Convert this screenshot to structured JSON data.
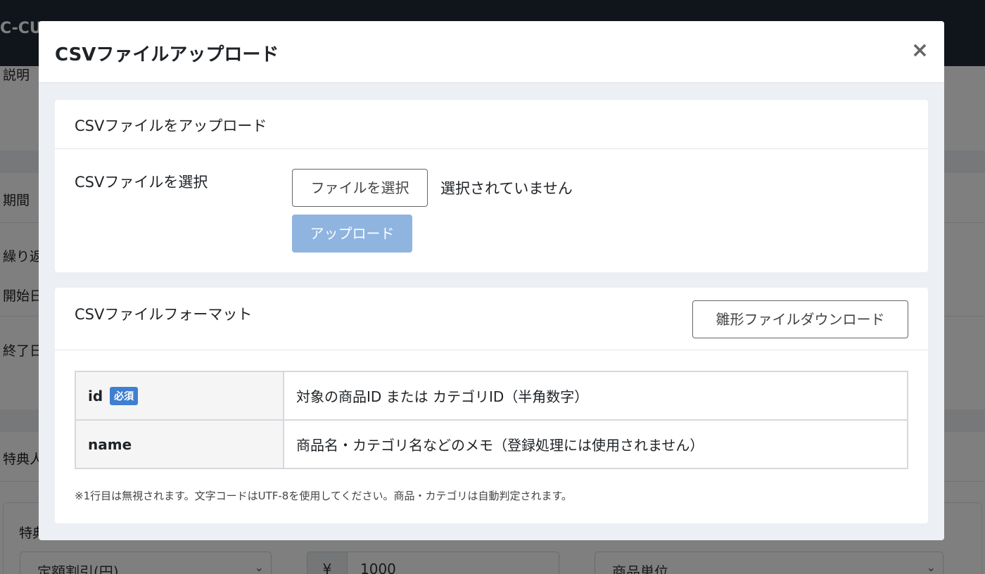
{
  "background": {
    "brand": "C-CU",
    "labels": [
      "説明",
      "期間",
      "繰り返",
      "開始日",
      "終了日",
      "特典人"
    ],
    "benefit_label": "特典",
    "discount_select": "定額割引(円)",
    "currency_symbol": "¥",
    "amount_value": "1000",
    "unit_select": "商品単位"
  },
  "modal": {
    "title": "CSVファイルアップロード",
    "close_label": "×",
    "upload_card": {
      "title": "CSVファイルをアップロード",
      "select_label": "CSVファイルを選択",
      "file_button": "ファイルを選択",
      "file_status": "選択されていません",
      "upload_button": "アップロード"
    },
    "format_card": {
      "title": "CSVファイルフォーマット",
      "template_button": "雛形ファイルダウンロード",
      "rows": [
        {
          "key": "id",
          "badge": "必須",
          "description": "対象の商品ID または カテゴリID（半角数字）"
        },
        {
          "key": "name",
          "description": "商品名・カテゴリ名などのメモ（登録処理には使用されません）"
        }
      ],
      "note": "※1行目は無視されます。文字コードはUTF-8を使用してください。商品・カテゴリは自動判定されます。"
    }
  },
  "colors": {
    "overlay": "rgba(0,0,0,0.5)",
    "badge": "#3f7fd0",
    "upload_button_disabled": "#8fb4e0"
  }
}
